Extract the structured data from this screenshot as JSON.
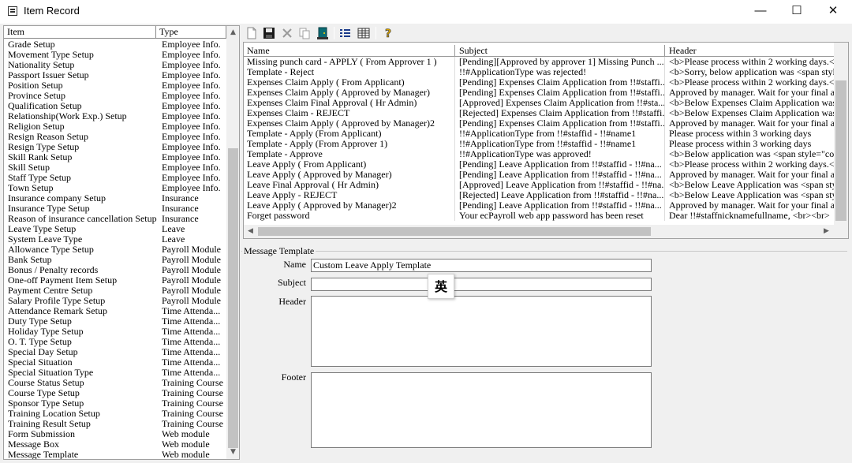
{
  "window": {
    "title": "Item Record",
    "icon": "record-list-icon",
    "controls": {
      "minimize": "—",
      "maximize": "☐",
      "close": "✕"
    }
  },
  "item_list": {
    "columns": [
      "Item",
      "Type"
    ],
    "rows": [
      {
        "item": "Grade Setup",
        "type": "Employee Info."
      },
      {
        "item": "Movement Type Setup",
        "type": "Employee Info."
      },
      {
        "item": "Nationality Setup",
        "type": "Employee Info."
      },
      {
        "item": "Passport Issuer Setup",
        "type": "Employee Info."
      },
      {
        "item": "Position Setup",
        "type": "Employee Info."
      },
      {
        "item": "Province Setup",
        "type": "Employee Info."
      },
      {
        "item": "Qualification Setup",
        "type": "Employee Info."
      },
      {
        "item": "Relationship(Work Exp.) Setup",
        "type": "Employee Info."
      },
      {
        "item": "Religion Setup",
        "type": "Employee Info."
      },
      {
        "item": "Resign Reason Setup",
        "type": "Employee Info."
      },
      {
        "item": "Resign Type Setup",
        "type": "Employee Info."
      },
      {
        "item": "Skill Rank Setup",
        "type": "Employee Info."
      },
      {
        "item": "Skill Setup",
        "type": "Employee Info."
      },
      {
        "item": "Staff Type Setup",
        "type": "Employee Info."
      },
      {
        "item": "Town Setup",
        "type": "Employee Info."
      },
      {
        "item": "Insurance company Setup",
        "type": "Insurance"
      },
      {
        "item": "Insurance Type Setup",
        "type": "Insurance"
      },
      {
        "item": "Reason of insurance cancellation Setup",
        "type": "Insurance"
      },
      {
        "item": "Leave Type Setup",
        "type": "Leave"
      },
      {
        "item": "System Leave Type",
        "type": "Leave"
      },
      {
        "item": "Allowance Type Setup",
        "type": "Payroll Module"
      },
      {
        "item": "Bank Setup",
        "type": "Payroll Module"
      },
      {
        "item": "Bonus / Penalty records",
        "type": "Payroll Module"
      },
      {
        "item": "One-off Payment Item Setup",
        "type": "Payroll Module"
      },
      {
        "item": "Payment Centre Setup",
        "type": "Payroll Module"
      },
      {
        "item": "Salary Profile Type Setup",
        "type": "Payroll Module"
      },
      {
        "item": "Attendance Remark Setup",
        "type": "Time Attenda..."
      },
      {
        "item": "Duty Type Setup",
        "type": "Time Attenda..."
      },
      {
        "item": "Holiday Type Setup",
        "type": "Time Attenda..."
      },
      {
        "item": "O. T. Type Setup",
        "type": "Time Attenda..."
      },
      {
        "item": "Special Day Setup",
        "type": "Time Attenda..."
      },
      {
        "item": "Special Situation",
        "type": "Time Attenda..."
      },
      {
        "item": "Special Situation Type",
        "type": "Time Attenda..."
      },
      {
        "item": "Course Status Setup",
        "type": "Training Course"
      },
      {
        "item": "Course Type Setup",
        "type": "Training Course"
      },
      {
        "item": "Sponsor Type Setup",
        "type": "Training Course"
      },
      {
        "item": "Training Location Setup",
        "type": "Training Course"
      },
      {
        "item": "Training Result Setup",
        "type": "Training Course"
      },
      {
        "item": "Form Submission",
        "type": "Web module"
      },
      {
        "item": "Message Box",
        "type": "Web module"
      },
      {
        "item": "Message Template",
        "type": "Web module"
      }
    ]
  },
  "toolbar": {
    "buttons": [
      {
        "name": "new-icon",
        "label": "New"
      },
      {
        "name": "save-icon",
        "label": "Save"
      },
      {
        "name": "delete-icon",
        "label": "Delete"
      },
      {
        "name": "copy-icon",
        "label": "Copy"
      },
      {
        "name": "exit-door-icon",
        "label": "Exit"
      },
      {
        "name": "list-view-icon",
        "label": "List"
      },
      {
        "name": "detail-view-icon",
        "label": "Details"
      },
      {
        "name": "help-icon",
        "label": "Help"
      }
    ]
  },
  "templates": {
    "columns": [
      "Name",
      "Subject",
      "Header"
    ],
    "rows": [
      {
        "name": "Missing punch card - APPLY ( From Approver 1 )",
        "subject": "[Pending][Approved by approver 1] Missing Punch ...",
        "header": "<b>Please process within 2 working days.</b"
      },
      {
        "name": "Template - Reject",
        "subject": "!!#ApplicationType was rejected!",
        "header": "<b>Sorry, below application was <span style"
      },
      {
        "name": "Expenses Claim Apply ( From Applicant)",
        "subject": "[Pending] Expenses Claim Application from !!#staffi...",
        "header": "<b>Please process within 2 working days.<b:"
      },
      {
        "name": "Expenses Claim Apply ( Approved by Manager)",
        "subject": "[Pending] Expenses Claim Application from !!#staffi...",
        "header": "Approved by manager. Wait for your final a"
      },
      {
        "name": "Expenses Claim Final Approval ( Hr Admin)",
        "subject": "[Approved] Expenses Claim Application from !!#sta...",
        "header": "<b>Below Expenses Claim Application was"
      },
      {
        "name": "Expenses Claim - REJECT",
        "subject": "[Rejected] Expenses Claim Application from !!#staffi...",
        "header": "<b>Below Expenses Claim Application was"
      },
      {
        "name": "Expenses Claim Apply ( Approved by Manager)2",
        "subject": "[Pending] Expenses Claim Application from !!#staffi...",
        "header": "Approved by manager. Wait for your final a"
      },
      {
        "name": "Template - Apply (From Applicant)",
        "subject": "!!#ApplicationType from !!#staffid - !!#name1",
        "header": "Please process within 3 working days"
      },
      {
        "name": "Template - Apply (From Approver 1)",
        "subject": "!!#ApplicationType from !!#staffid - !!#name1",
        "header": "Please process within 3 working days"
      },
      {
        "name": "Template - Approve",
        "subject": "!!#ApplicationType was approved!",
        "header": "<b>Below application was <span style=\"colo"
      },
      {
        "name": "Leave Apply ( From Applicant)",
        "subject": "[Pending] Leave Application from !!#staffid - !!#na...",
        "header": "<b>Please process within 2 working days.<b:"
      },
      {
        "name": "Leave Apply ( Approved by Manager)",
        "subject": "[Pending] Leave Application from !!#staffid - !!#na...",
        "header": "Approved by manager. Wait for your final a"
      },
      {
        "name": "Leave Final Approval ( Hr Admin)",
        "subject": "[Approved] Leave Application from !!#staffid - !!#na...",
        "header": "<b>Below Leave Application was <span style"
      },
      {
        "name": "Leave Apply - REJECT",
        "subject": "[Rejected] Leave Application from !!#staffid - !!#na...",
        "header": "<b>Below Leave Application was <span style"
      },
      {
        "name": "Leave Apply ( Approved by Manager)2",
        "subject": "[Pending] Leave Application from !!#staffid - !!#na...",
        "header": "Approved by manager. Wait for your final a"
      },
      {
        "name": "Forget password",
        "subject": "Your ecPayroll web app password has been reset",
        "header": "Dear !!#staffnicknamefullname,   <br><br>"
      }
    ]
  },
  "message_template": {
    "group_title": "Message Template",
    "name_label": "Name",
    "name_value": "Custom Leave Apply Template",
    "subject_label": "Subject",
    "subject_value": "",
    "header_label": "Header",
    "header_value": "",
    "footer_label": "Footer",
    "footer_value": ""
  },
  "ime_indicator": "英"
}
